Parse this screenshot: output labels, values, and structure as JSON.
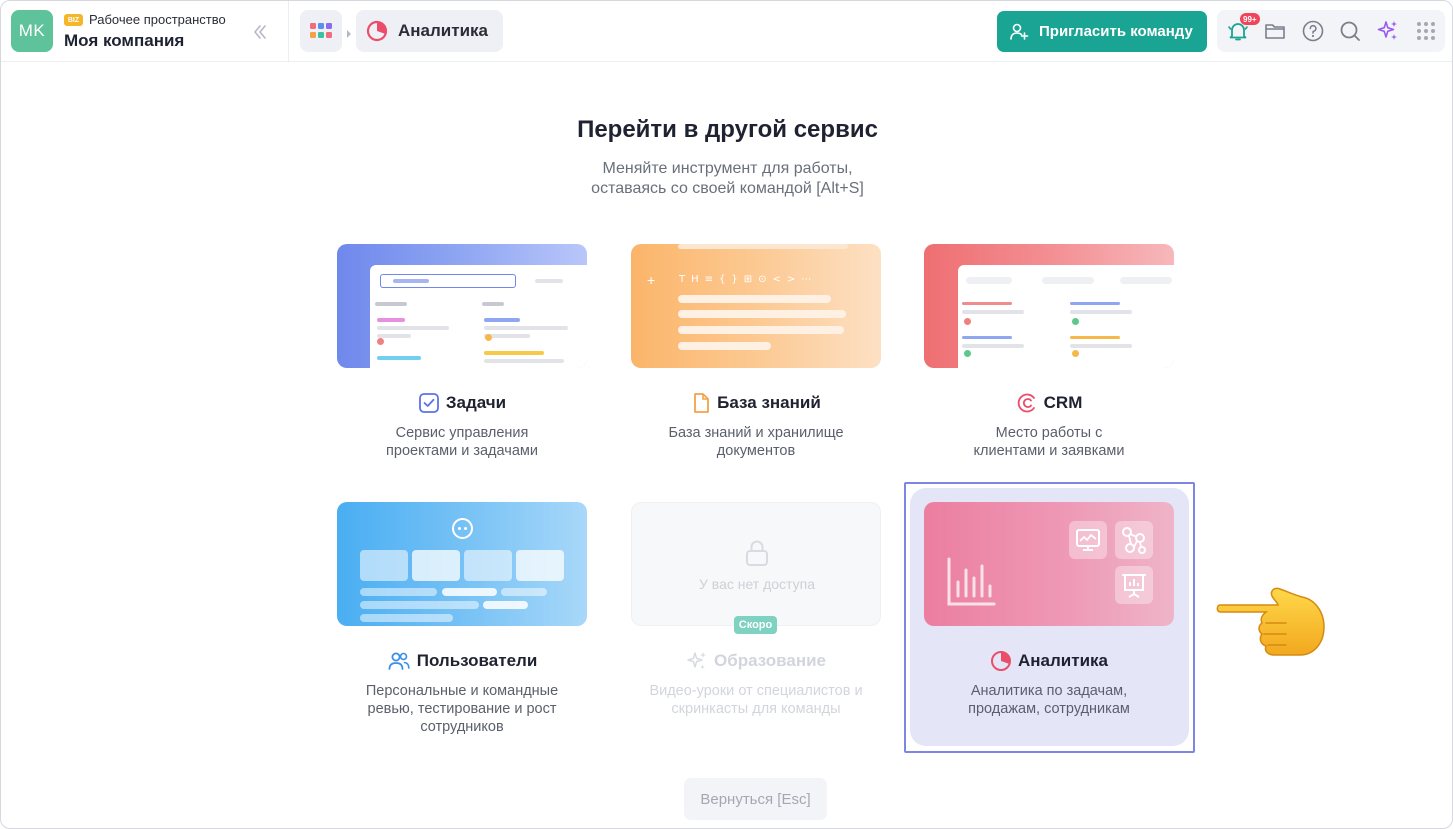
{
  "workspace": {
    "avatar_initials": "MK",
    "badge": "BIZ",
    "label": "Рабочее пространство",
    "company": "Моя компания"
  },
  "breadcrumb": {
    "current": "Аналитика"
  },
  "header": {
    "invite_label": "Пригласить команду",
    "notifications_count": "99+"
  },
  "main": {
    "title": "Перейти в другой сервис",
    "subtitle_line1": "Меняйте инструмент для работы,",
    "subtitle_line2": "оставаясь со своей командой [Alt+S]",
    "back_label": "Вернуться [Esc]"
  },
  "services": [
    {
      "name": "Задачи",
      "desc1": "Сервис управления",
      "desc2": "проектами и задачами",
      "desc3": "",
      "icon": "checkbox-icon"
    },
    {
      "name": "База знаний",
      "desc1": "База знаний и хранилище",
      "desc2": "документов",
      "desc3": "",
      "icon": "document-icon"
    },
    {
      "name": "CRM",
      "desc1": "Место работы с",
      "desc2": "клиентами и заявками",
      "desc3": "",
      "icon": "crm-icon"
    },
    {
      "name": "Пользователи",
      "desc1": "Персональные и командные",
      "desc2": "ревью, тестирование и рост",
      "desc3": "сотрудников",
      "icon": "users-icon"
    },
    {
      "name": "Образование",
      "desc1": "Видео-уроки от специалистов и",
      "desc2": "скринкасты для команды",
      "desc3": "",
      "icon": "sparkle-icon",
      "locked_text": "У вас нет доступа",
      "soon_badge": "Скоро"
    },
    {
      "name": "Аналитика",
      "desc1": "Аналитика по задачам,",
      "desc2": "продажам, сотрудникам",
      "desc3": "",
      "icon": "analytics-icon",
      "selected": true
    }
  ],
  "colors": {
    "accent": "#1aa493",
    "selection": "#7d86e3",
    "avatar": "#5ec39a"
  }
}
